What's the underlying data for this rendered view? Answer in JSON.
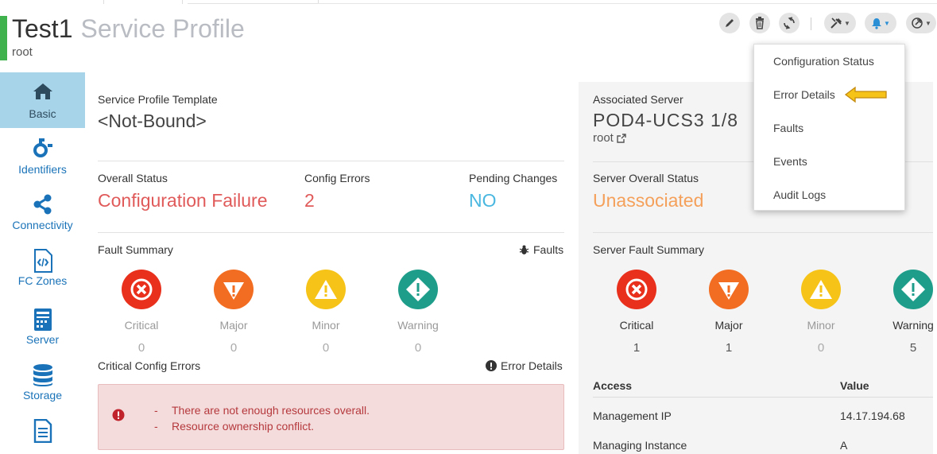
{
  "header": {
    "name": "Test1",
    "kind": "Service Profile",
    "org": "root"
  },
  "dropdown": {
    "items": [
      "Configuration Status",
      "Error Details",
      "Faults",
      "Events",
      "Audit Logs"
    ]
  },
  "sidebar": {
    "items": [
      {
        "label": "Basic",
        "icon": "home-icon",
        "active": true
      },
      {
        "label": "Identifiers",
        "icon": "identifiers-icon"
      },
      {
        "label": "Connectivity",
        "icon": "share-icon"
      },
      {
        "label": "FC Zones",
        "icon": "code-file-icon"
      },
      {
        "label": "Server",
        "icon": "server-icon"
      },
      {
        "label": "Storage",
        "icon": "database-icon"
      },
      {
        "label": "",
        "icon": "document-icon"
      }
    ]
  },
  "main": {
    "template_label": "Service Profile Template",
    "template_value": "<Not-Bound>",
    "overall_status_label": "Overall Status",
    "overall_status_value": "Configuration Failure",
    "config_errors_label": "Config Errors",
    "config_errors_value": "2",
    "pending_changes_label": "Pending Changes",
    "pending_changes_value": "NO",
    "fault_summary_label": "Fault Summary",
    "faults_link": "Faults",
    "faults": [
      {
        "label": "Critical",
        "count": "0"
      },
      {
        "label": "Major",
        "count": "0"
      },
      {
        "label": "Minor",
        "count": "0"
      },
      {
        "label": "Warning",
        "count": "0"
      }
    ],
    "critical_config_errors_label": "Critical Config Errors",
    "error_details_link": "Error Details",
    "errors": [
      "There are not enough resources overall.",
      "Resource ownership conflict."
    ]
  },
  "right": {
    "associated_server_label": "Associated Server",
    "associated_server_value": "POD4-UCS3 1/8",
    "associated_server_org": "root",
    "server_overall_status_label": "Server Overall Status",
    "server_overall_status_value": "Unassociated",
    "server_fault_summary_label": "Server Fault Summary",
    "faults": [
      {
        "label": "Critical",
        "count": "1"
      },
      {
        "label": "Major",
        "count": "1"
      },
      {
        "label": "Minor",
        "count": "0"
      },
      {
        "label": "Warning",
        "count": "5"
      }
    ],
    "table_header_access": "Access",
    "table_header_value": "Value",
    "rows": [
      {
        "access": "Management IP",
        "value": "14.17.194.68"
      },
      {
        "access": "Managing Instance",
        "value": "A"
      }
    ]
  },
  "colors": {
    "accent_green": "#3fb24d",
    "failure_red": "#e05a5a",
    "info_blue": "#49b7e0",
    "unassociated_orange": "#f5a05a",
    "nav_active": "#a8d4ea"
  }
}
